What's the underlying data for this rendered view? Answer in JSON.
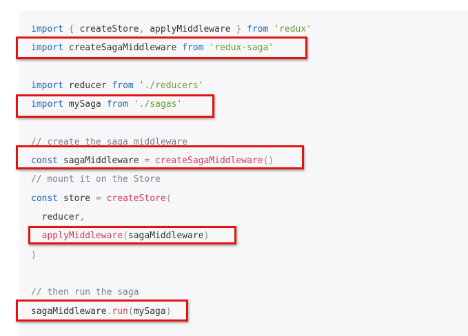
{
  "colors": {
    "keyword": "#1a64b4",
    "string": "#679a2e",
    "function": "#d23d50",
    "comment": "#7a8189",
    "punct": "#8c8c8c",
    "text": "#333333",
    "highlight": "#e3140f",
    "background": "#f7f7f9"
  },
  "code": {
    "lines": [
      [
        [
          "keyword",
          "import"
        ],
        [
          "text",
          " "
        ],
        [
          "punct",
          "{"
        ],
        [
          "text",
          " createStore"
        ],
        [
          "punct",
          ","
        ],
        [
          "text",
          " applyMiddleware "
        ],
        [
          "punct",
          "}"
        ],
        [
          "text",
          " "
        ],
        [
          "keyword",
          "from"
        ],
        [
          "text",
          " "
        ],
        [
          "string",
          "'redux'"
        ]
      ],
      [
        [
          "keyword",
          "import"
        ],
        [
          "text",
          " createSagaMiddleware "
        ],
        [
          "keyword",
          "from"
        ],
        [
          "text",
          " "
        ],
        [
          "string",
          "'redux-saga'"
        ]
      ],
      [],
      [
        [
          "keyword",
          "import"
        ],
        [
          "text",
          " reducer "
        ],
        [
          "keyword",
          "from"
        ],
        [
          "text",
          " "
        ],
        [
          "string",
          "'./reducers'"
        ]
      ],
      [
        [
          "keyword",
          "import"
        ],
        [
          "text",
          " mySaga "
        ],
        [
          "keyword",
          "from"
        ],
        [
          "text",
          " "
        ],
        [
          "string",
          "'./sagas'"
        ]
      ],
      [],
      [
        [
          "comment",
          "// create the saga middleware"
        ]
      ],
      [
        [
          "keyword",
          "const"
        ],
        [
          "text",
          " sagaMiddleware "
        ],
        [
          "punct",
          "="
        ],
        [
          "text",
          " "
        ],
        [
          "function",
          "createSagaMiddleware"
        ],
        [
          "punct",
          "()"
        ]
      ],
      [
        [
          "comment",
          "// mount it on the Store"
        ]
      ],
      [
        [
          "keyword",
          "const"
        ],
        [
          "text",
          " store "
        ],
        [
          "punct",
          "="
        ],
        [
          "text",
          " "
        ],
        [
          "function",
          "createStore"
        ],
        [
          "punct",
          "("
        ]
      ],
      [
        [
          "text",
          "  reducer"
        ],
        [
          "punct",
          ","
        ]
      ],
      [
        [
          "text",
          "  "
        ],
        [
          "function",
          "applyMiddleware"
        ],
        [
          "punct",
          "("
        ],
        [
          "text",
          "sagaMiddleware"
        ],
        [
          "punct",
          ")"
        ]
      ],
      [
        [
          "punct",
          ")"
        ]
      ],
      [],
      [
        [
          "comment",
          "// then run the saga"
        ]
      ],
      [
        [
          "text",
          "sagaMiddleware"
        ],
        [
          "punct",
          "."
        ],
        [
          "function",
          "run"
        ],
        [
          "punct",
          "("
        ],
        [
          "text",
          "mySaga"
        ],
        [
          "punct",
          ")"
        ]
      ]
    ]
  }
}
